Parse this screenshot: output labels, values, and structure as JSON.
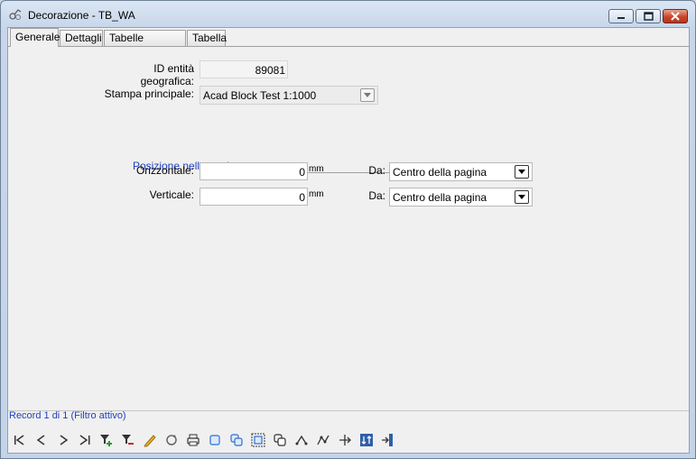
{
  "window": {
    "title": "Decorazione - TB_WA",
    "icon": "feature-class-icon",
    "controls": [
      "minimize-icon",
      "maximize-icon",
      "close-icon"
    ]
  },
  "tabs": [
    {
      "label": "Generale",
      "active": true
    },
    {
      "label": "Dettagli",
      "active": false
    },
    {
      "label": "Tabelle correlate",
      "active": false
    },
    {
      "label": "Tabella",
      "active": false
    }
  ],
  "form": {
    "id_label": "ID entità geografica:",
    "id_value": "89081",
    "stampa_label": "Stampa principale:",
    "stampa_value": "Acad Block Test 1:1000",
    "section_title": "Posizione nella pagina",
    "orizzontale_label": "Orizzontale:",
    "orizzontale_value": "0",
    "orizzontale_unit": "mm",
    "orizzontale_da_label": "Da:",
    "orizzontale_da_value": "Centro della pagina",
    "verticale_label": "Verticale:",
    "verticale_value": "0",
    "verticale_unit": "mm",
    "verticale_da_label": "Da:",
    "verticale_da_value": "Centro della pagina"
  },
  "status": {
    "record_text": "Record 1 di 1 (Filtro attivo)"
  },
  "toolbar": {
    "icons": [
      "first-record-icon",
      "previous-record-icon",
      "next-record-icon",
      "last-record-icon",
      "add-filter-icon",
      "remove-filter-icon",
      "edit-pencil-icon",
      "refresh-icon",
      "print-icon",
      "select-feature-icon",
      "select-multiple-icon",
      "zoom-extent-icon",
      "pan-icon",
      "undo-icon",
      "redo-icon",
      "move-icon",
      "sort-icon",
      "exit-icon"
    ]
  },
  "colors": {
    "link_blue": "#1f3fbf",
    "panel_bg": "#f0f0f0",
    "titlebar_bg": "#c7d6ea",
    "close_red": "#c8452b"
  }
}
